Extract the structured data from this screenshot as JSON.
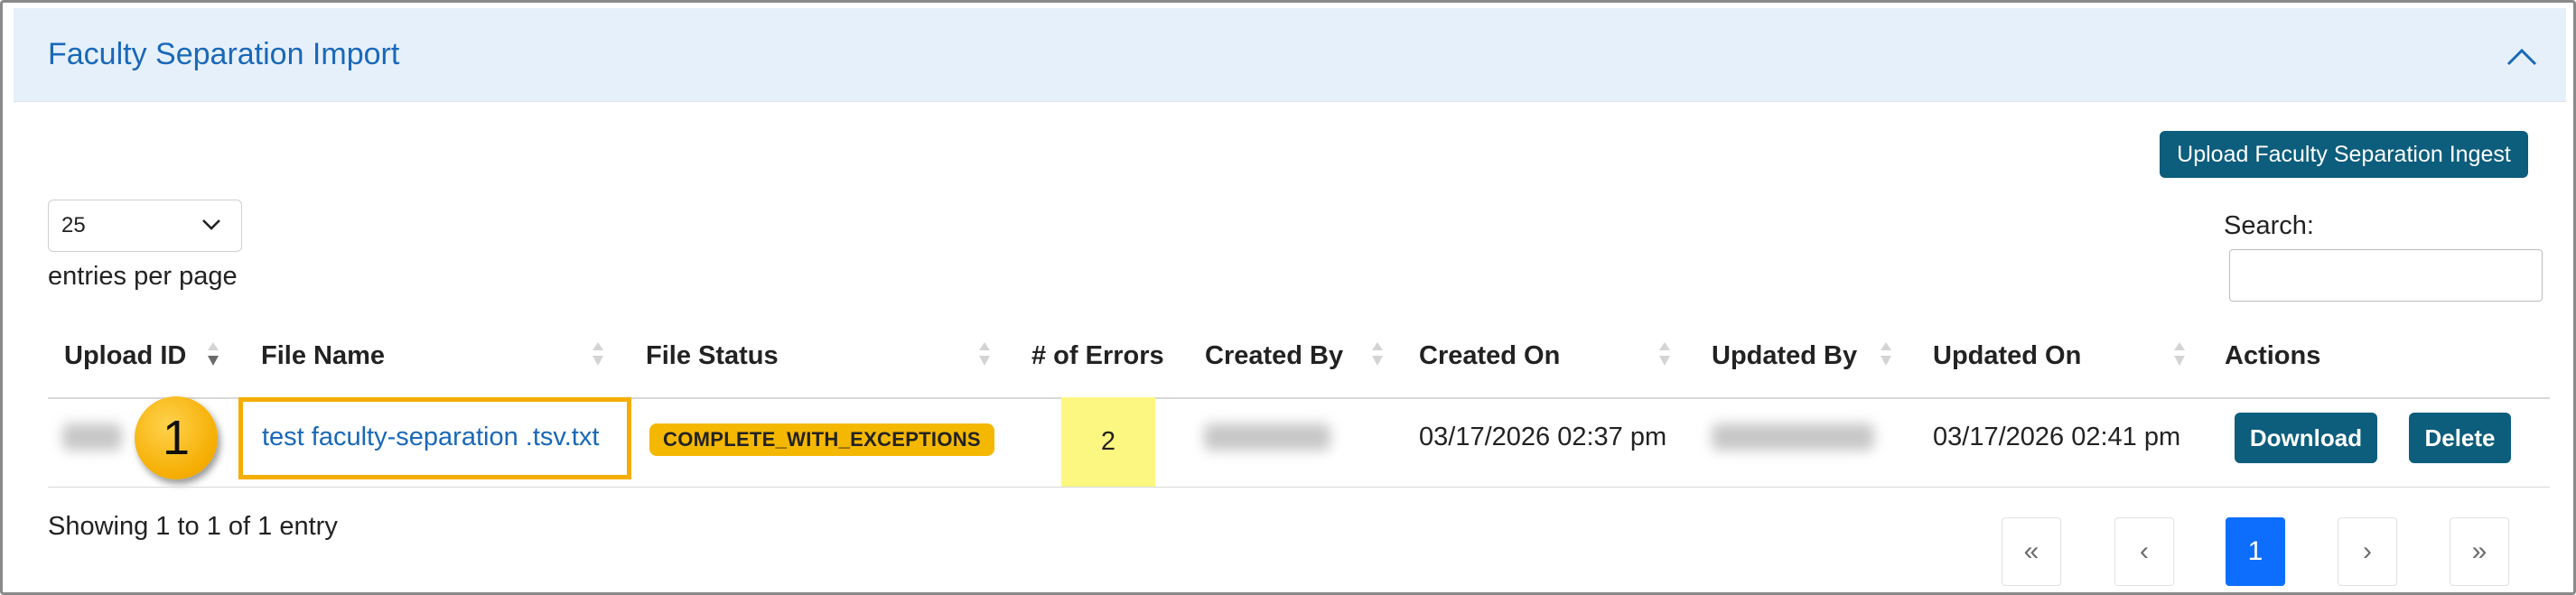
{
  "panel": {
    "title": "Faculty Separation Import",
    "collapse_icon": "chevron-up-icon"
  },
  "toolbar": {
    "upload_button": "Upload Faculty Separation Ingest"
  },
  "length_menu": {
    "selected": "25",
    "label": "entries per page"
  },
  "search": {
    "label": "Search:",
    "value": ""
  },
  "table": {
    "columns": [
      "Upload ID",
      "File Name",
      "File Status",
      "# of Errors",
      "Created By",
      "Created On",
      "Updated By",
      "Updated On",
      "Actions"
    ],
    "rows": [
      {
        "file_name": "test faculty-separation .tsv.txt",
        "file_status": "COMPLETE_WITH_EXCEPTIONS",
        "errors": "2",
        "created_on": "03/17/2026 02:37 pm",
        "updated_on": "03/17/2026 02:41 pm",
        "actions": [
          "Download",
          "Delete"
        ]
      }
    ]
  },
  "callout_number": "1",
  "info": "Showing 1 to 1 of 1 entry",
  "pagination": {
    "first": "«",
    "prev": "‹",
    "current": "1",
    "next": "›",
    "last": "»"
  },
  "colors": {
    "header_bg": "#e6f0fb",
    "title_blue": "#1a68b8",
    "button_teal": "#0d5d7c",
    "badge_yellow": "#f5b800",
    "highlight_yellow": "#fcf781",
    "active_page": "#0d6efd"
  }
}
